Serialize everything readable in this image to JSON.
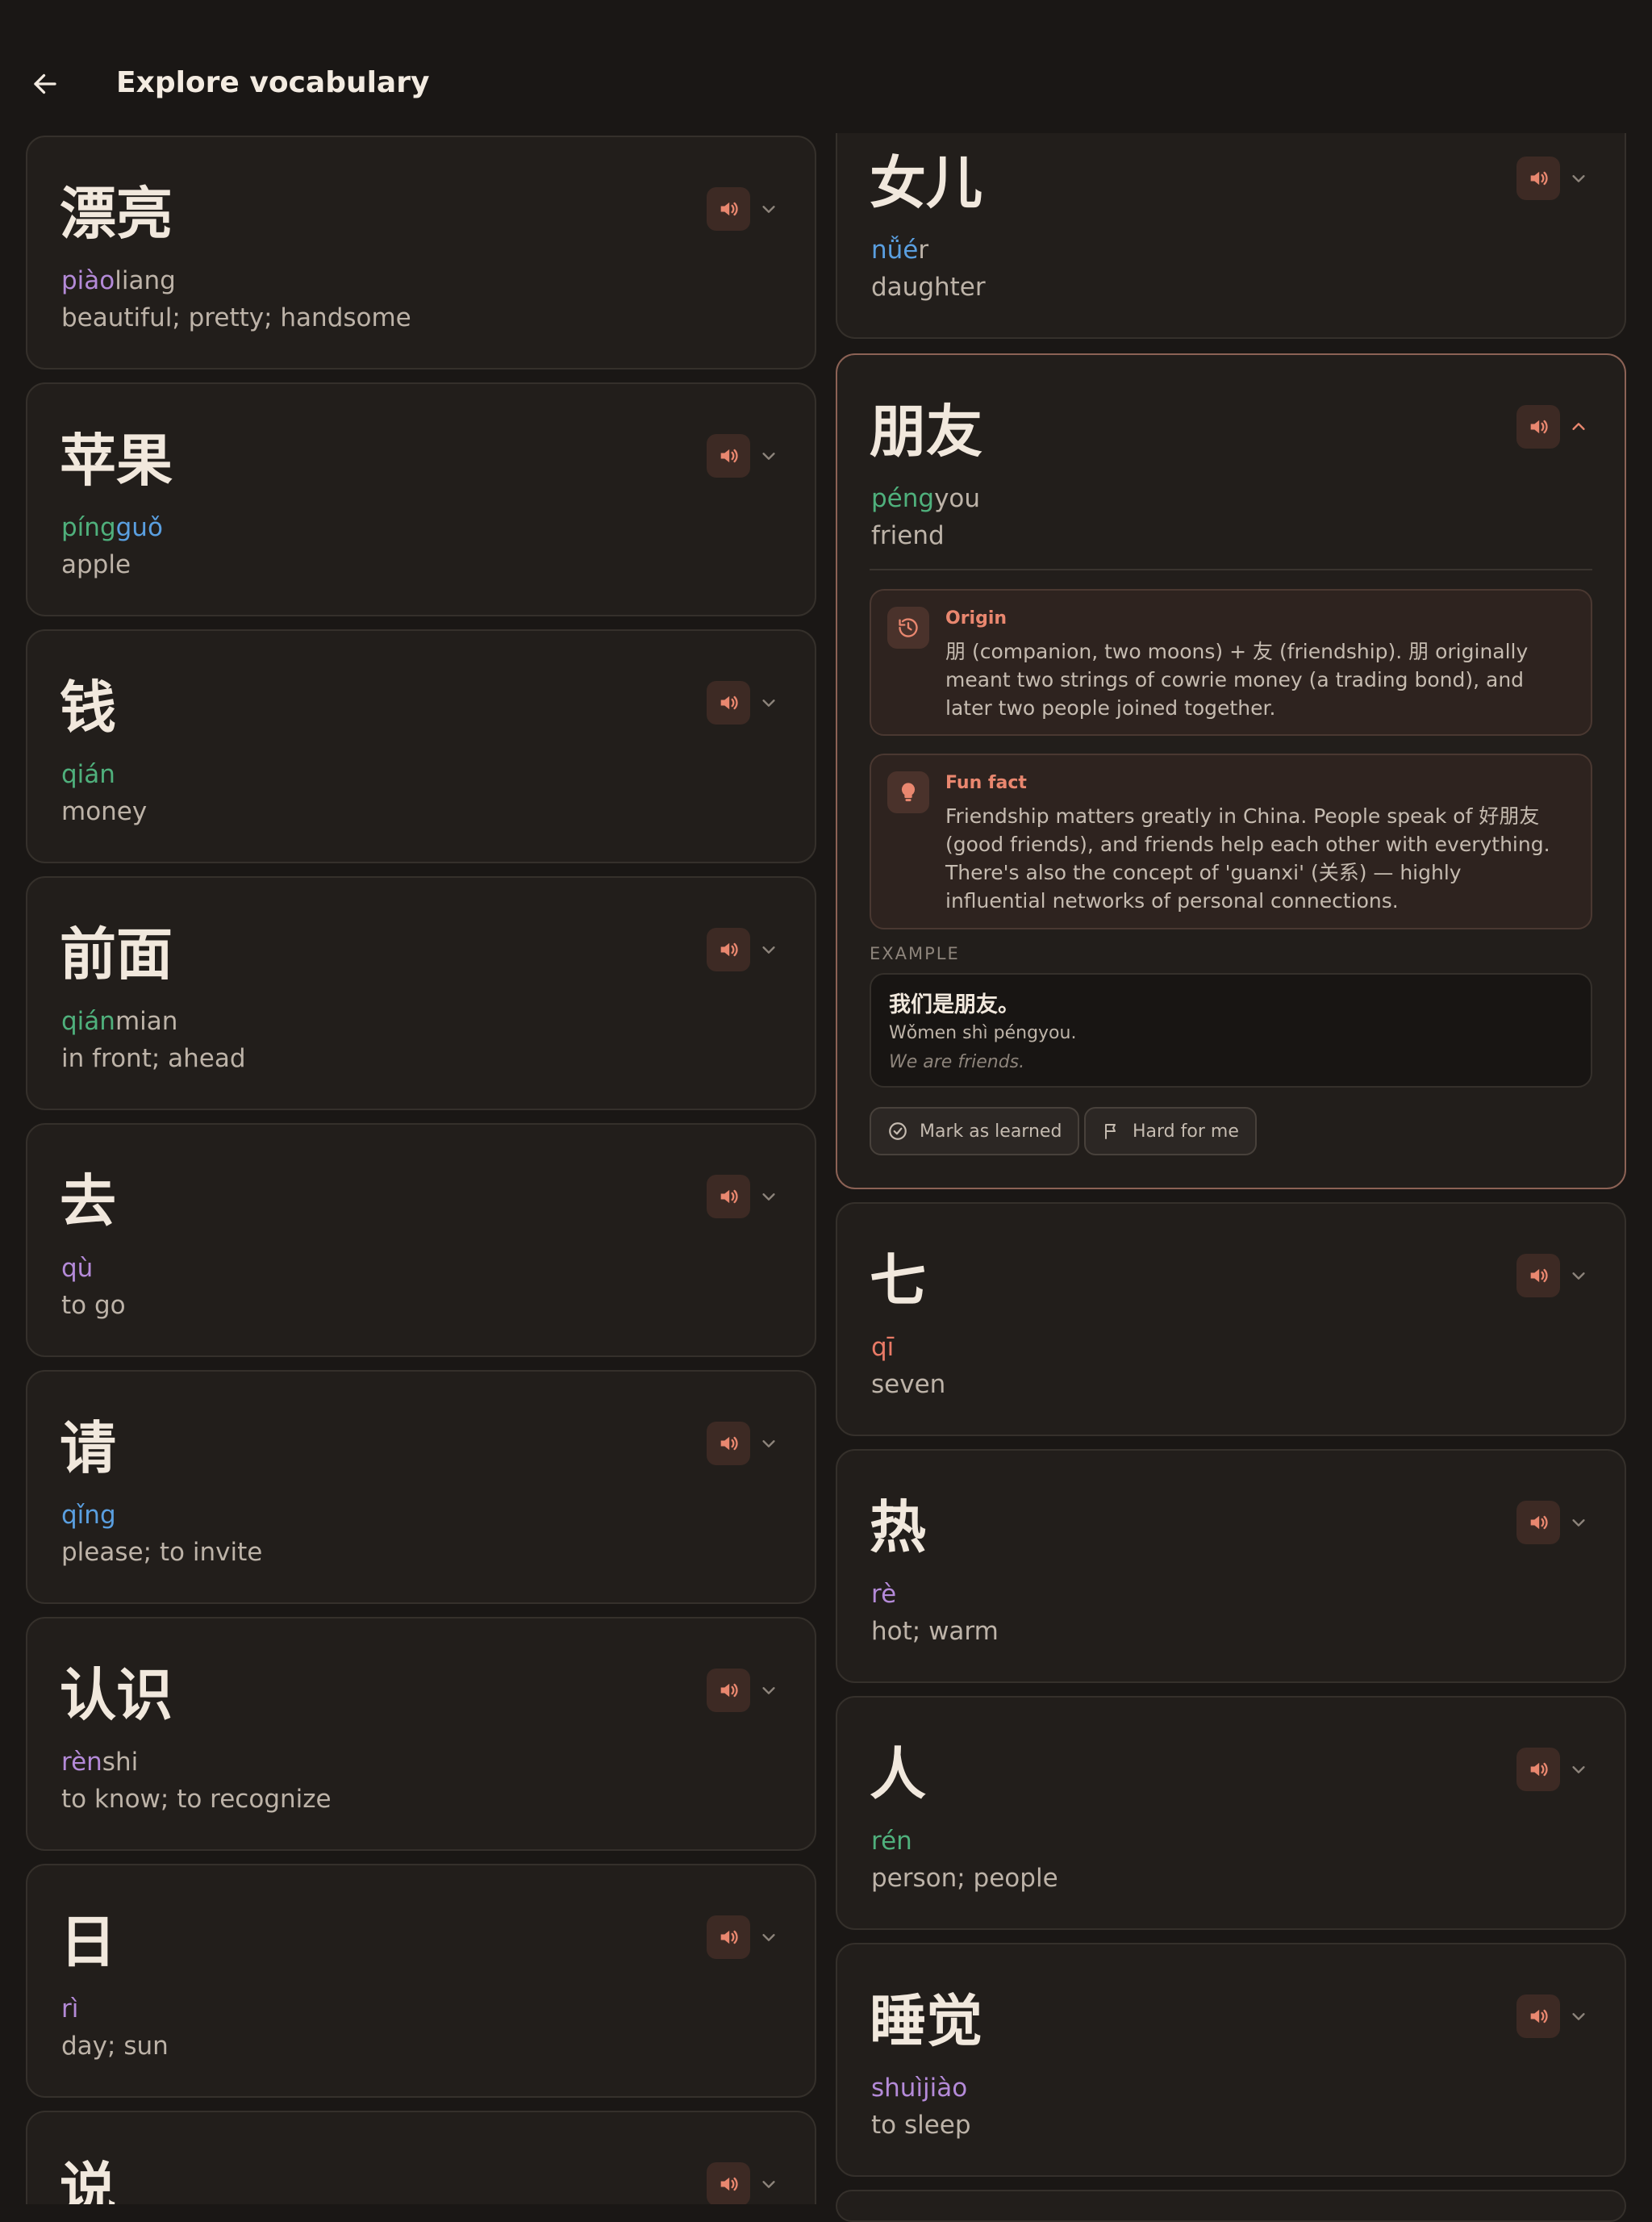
{
  "header": {
    "title": "Explore vocabulary"
  },
  "left_cards": [
    {
      "hanzi": "漂亮",
      "pinyin": [
        {
          "t": "piào",
          "tone": 4
        },
        {
          "t": "liang",
          "tone": 0
        }
      ],
      "meaning": "beautiful; pretty; handsome"
    },
    {
      "hanzi": "苹果",
      "pinyin": [
        {
          "t": "píng",
          "tone": 2
        },
        {
          "t": "guǒ",
          "tone": 3
        }
      ],
      "meaning": "apple"
    },
    {
      "hanzi": "钱",
      "pinyin": [
        {
          "t": "qián",
          "tone": 2
        }
      ],
      "meaning": "money"
    },
    {
      "hanzi": "前面",
      "pinyin": [
        {
          "t": "qián",
          "tone": 2
        },
        {
          "t": "mian",
          "tone": 0
        }
      ],
      "meaning": "in front; ahead"
    },
    {
      "hanzi": "去",
      "pinyin": [
        {
          "t": "qù",
          "tone": 4
        }
      ],
      "meaning": "to go"
    },
    {
      "hanzi": "请",
      "pinyin": [
        {
          "t": "qǐng",
          "tone": 3
        }
      ],
      "meaning": "please; to invite"
    },
    {
      "hanzi": "认识",
      "pinyin": [
        {
          "t": "rèn",
          "tone": 4
        },
        {
          "t": "shi",
          "tone": 0
        }
      ],
      "meaning": "to know; to recognize"
    },
    {
      "hanzi": "日",
      "pinyin": [
        {
          "t": "rì",
          "tone": 4
        }
      ],
      "meaning": "day; sun"
    },
    {
      "hanzi": "说",
      "pinyin": [],
      "meaning": ""
    }
  ],
  "right_cards": [
    {
      "hanzi": "女儿",
      "pinyin": [
        {
          "t": "nǚé",
          "tone": 3
        },
        {
          "t": "r",
          "tone": 0
        }
      ],
      "meaning": "daughter"
    },
    {
      "hanzi": "朋友",
      "pinyin": [
        {
          "t": "péng",
          "tone": 2
        },
        {
          "t": "you",
          "tone": 0
        }
      ],
      "meaning": "friend"
    },
    {
      "hanzi": "七",
      "pinyin": [
        {
          "t": "qī",
          "tone": 1
        }
      ],
      "meaning": "seven"
    },
    {
      "hanzi": "热",
      "pinyin": [
        {
          "t": "rè",
          "tone": 4
        }
      ],
      "meaning": "hot; warm"
    },
    {
      "hanzi": "人",
      "pinyin": [
        {
          "t": "rén",
          "tone": 2
        }
      ],
      "meaning": "person; people"
    },
    {
      "hanzi": "睡觉",
      "pinyin": [
        {
          "t": "shuìjiào",
          "tone": 4
        }
      ],
      "meaning": "to sleep"
    }
  ],
  "expanded": {
    "origin_label": "Origin",
    "origin_text": "朋 (companion, two moons) + 友 (friendship). 朋 originally meant two strings of cowrie money (a trading bond), and later two people joined together.",
    "funfact_label": "Fun fact",
    "funfact_text": "Friendship matters greatly in China. People speak of 好朋友 (good friends), and friends help each other with everything. There's also the concept of 'guanxi' (关系) — highly influential networks of personal connections.",
    "example_label": "EXAMPLE",
    "example_zh": "我们是朋友。",
    "example_pinyin": "Wǒmen shì péngyou.",
    "example_en": "We are friends.",
    "mark_learned": "Mark as learned",
    "hard_for_me": "Hard for me"
  },
  "colors": {
    "tone1": "#e97a66",
    "tone2": "#4fb07c",
    "tone3": "#5a9fe0",
    "tone4": "#b48ad8",
    "accent": "#e9876f"
  }
}
